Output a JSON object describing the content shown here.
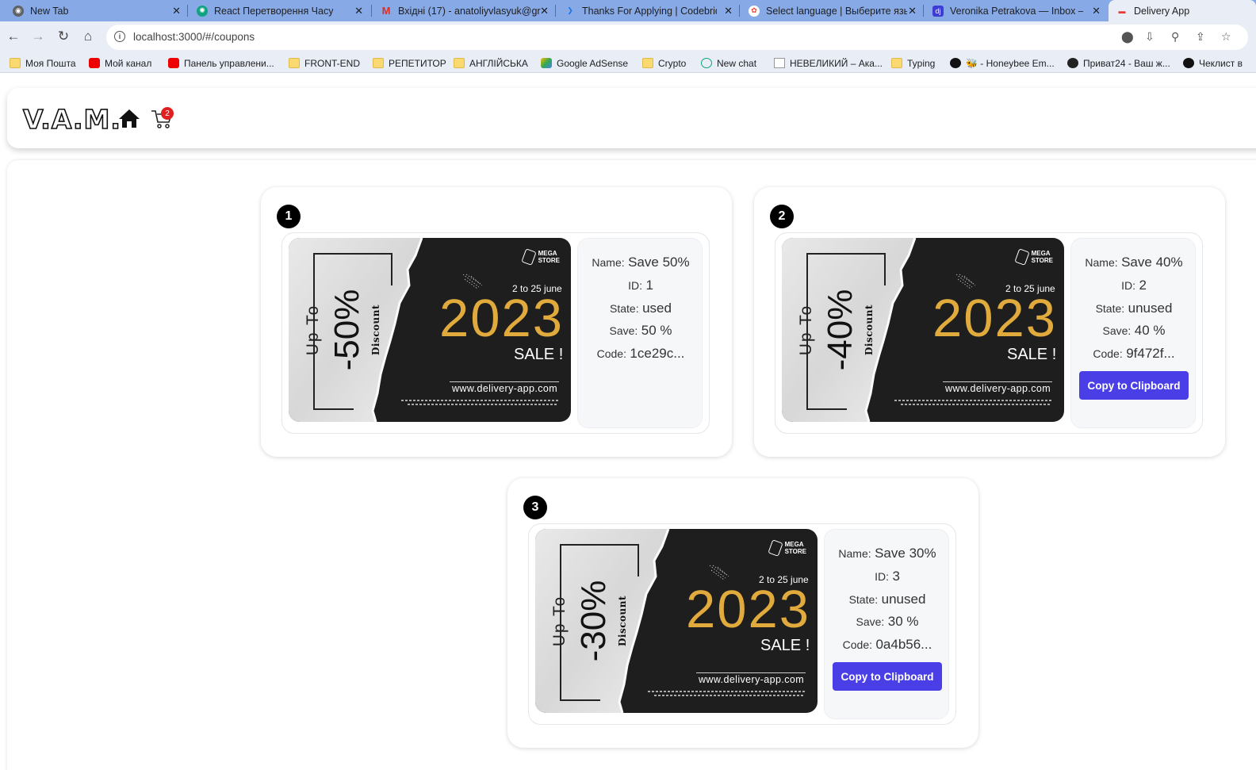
{
  "browser": {
    "tabs": [
      {
        "title": "New Tab",
        "icon": "chrome-icon"
      },
      {
        "title": "React Перетворення Часу",
        "icon": "openai-icon"
      },
      {
        "title": "Вхідні (17) - anatoliyvlasyuk@gr",
        "icon": "gmail-icon"
      },
      {
        "title": "Thanks For Applying | Codebridge",
        "icon": "codebridge-icon"
      },
      {
        "title": "Select language | Выберите язы",
        "icon": "globe-icon"
      },
      {
        "title": "Veronika Petrakova — Inbox —",
        "icon": "djinni-icon"
      },
      {
        "title": "Delivery App",
        "icon": "delivery-icon"
      }
    ],
    "url": "localhost:3000/#/coupons",
    "bookmarks": [
      "Моя Пошта",
      "Мой канал",
      "Панель управлени...",
      "FRONT-END",
      "РЕПЕТИТОР",
      "АНГЛІЙСЬКА",
      "Google AdSense",
      "Crypto",
      "New chat",
      "НЕВЕЛИКИЙ – Ака...",
      "Typing",
      "🐝 - Honeybee Em...",
      "Приват24 - Ваш ж...",
      "Чеклист в"
    ]
  },
  "header": {
    "logo": "V.A.M.",
    "cart_count": "2"
  },
  "labels": {
    "name": "Name:",
    "id": "ID:",
    "state": "State:",
    "save": "Save:",
    "code": "Code:",
    "copy_button": "Copy to Clipboard"
  },
  "banner": {
    "up_to": "Up To",
    "discount_word": "Discount",
    "store": [
      "MEGA",
      "STORE"
    ],
    "date_range": "2 to 25 june",
    "year": "2023",
    "sale": "SALE !",
    "site_url": "www.delivery-app.com"
  },
  "coupons": [
    {
      "number": "1",
      "percent": "-50%",
      "name": "Save 50%",
      "id": "1",
      "state": "used",
      "save": "50 %",
      "code": "1ce29c..."
    },
    {
      "number": "2",
      "percent": "-40%",
      "name": "Save 40%",
      "id": "2",
      "state": "unused",
      "save": "40 %",
      "code": "9f472f..."
    },
    {
      "number": "3",
      "percent": "-30%",
      "name": "Save 30%",
      "id": "3",
      "state": "unused",
      "save": "30 %",
      "code": "0a4b56..."
    }
  ],
  "colors": {
    "accent_button": "#4a3ee6",
    "year_gold": "#e1aa3c",
    "cart_badge": "#e02020"
  }
}
